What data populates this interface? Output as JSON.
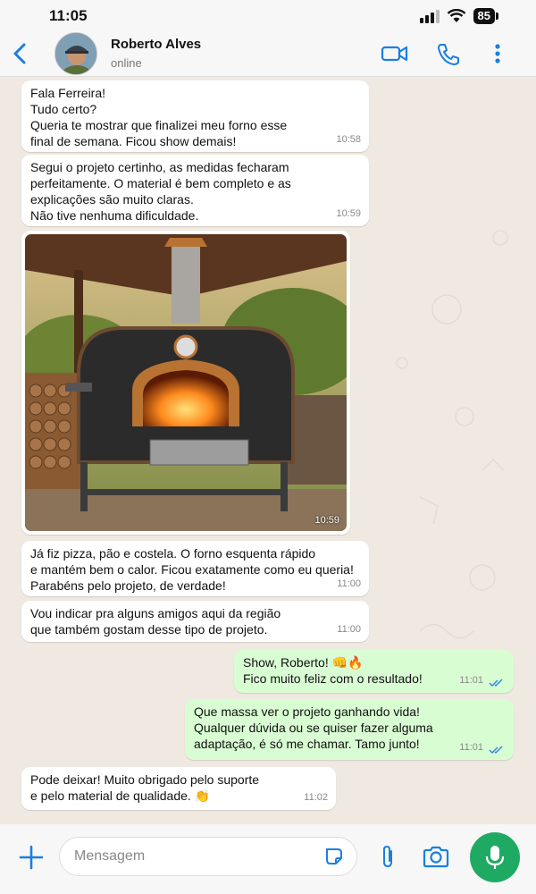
{
  "status_bar": {
    "time": "11:05",
    "battery": "85"
  },
  "header": {
    "contact_name": "Roberto Alves",
    "contact_status": "online"
  },
  "messages": [
    {
      "direction": "in",
      "text": "Fala Ferreira!\nTudo certo?\nQueria te mostrar que finalizei meu forno esse\nfinal de semana. Ficou show demais!",
      "time": "10:58"
    },
    {
      "direction": "in",
      "text": "Segui o projeto certinho, as medidas fecharam\nperfeitamente. O material é bem completo e as\nexplicações são muito claras.\nNão tive nenhuma dificuldade.",
      "time": "10:59"
    },
    {
      "direction": "in",
      "type": "photo",
      "time": "10:59"
    },
    {
      "direction": "in",
      "text": "Já fiz pizza, pão e costela. O forno esquenta rápido\ne mantém bem o calor. Ficou exatamente como eu queria!\nParabéns pelo projeto, de verdade!",
      "time": "11:00"
    },
    {
      "direction": "in",
      "text": "Vou indicar pra alguns amigos aqui da região\nque também gostam desse tipo de projeto.",
      "time": "11:00"
    },
    {
      "direction": "out",
      "text": "Show, Roberto! 👊🔥\nFico muito feliz com o resultado!",
      "time": "11:01",
      "read": true
    },
    {
      "direction": "out",
      "text": "Que massa ver o projeto ganhando vida!\nQualquer dúvida ou se quiser fazer alguma\nadaptação, é só me chamar. Tamo junto!",
      "time": "11:01",
      "read": true
    },
    {
      "direction": "in",
      "text": "Pode deixar! Muito obrigado pelo suporte\ne pelo material de qualidade. 👏",
      "time": "11:02"
    }
  ],
  "input": {
    "placeholder": "Mensagem"
  },
  "colors": {
    "outgoing_bubble": "#d9fdd3",
    "incoming_bubble": "#ffffff",
    "accent": "#1a7fe0",
    "mic_button": "#1faa63"
  }
}
